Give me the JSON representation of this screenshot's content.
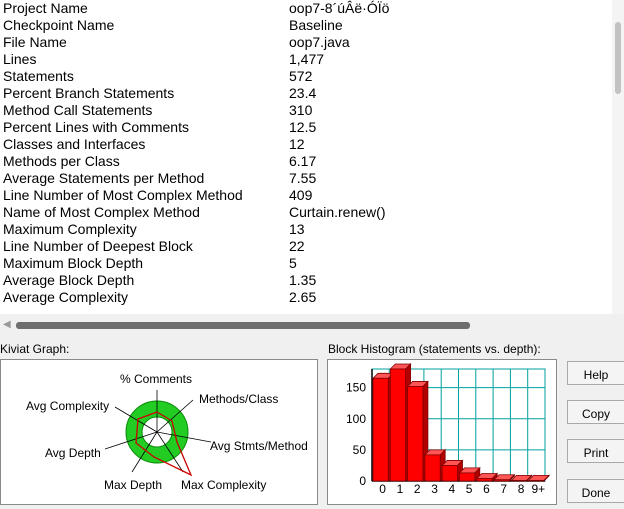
{
  "metrics": [
    {
      "label": "Project Name",
      "value": "oop7-8´úÂë·ÓÏö"
    },
    {
      "label": "Checkpoint Name",
      "value": "Baseline"
    },
    {
      "label": "File Name",
      "value": "oop7.java"
    },
    {
      "label": "Lines",
      "value": "1,477"
    },
    {
      "label": "Statements",
      "value": "572"
    },
    {
      "label": "Percent Branch Statements",
      "value": "23.4"
    },
    {
      "label": "Method Call Statements",
      "value": "310"
    },
    {
      "label": "Percent Lines with Comments",
      "value": "12.5"
    },
    {
      "label": "Classes and Interfaces",
      "value": "12"
    },
    {
      "label": "Methods per Class",
      "value": "6.17"
    },
    {
      "label": "Average Statements per Method",
      "value": "7.55"
    },
    {
      "label": "Line Number of Most Complex Method",
      "value": "409"
    },
    {
      "label": "Name of Most Complex Method",
      "value": "Curtain.renew()"
    },
    {
      "label": "Maximum Complexity",
      "value": "13"
    },
    {
      "label": "Line Number of Deepest Block",
      "value": "22"
    },
    {
      "label": "Maximum Block Depth",
      "value": "5"
    },
    {
      "label": "Average Block Depth",
      "value": "1.35"
    },
    {
      "label": "Average Complexity",
      "value": "2.65"
    }
  ],
  "kiviat": {
    "title": "Kiviat Graph:",
    "axes": [
      "% Comments",
      "Methods/Class",
      "Avg Stmts/Method",
      "Max Complexity",
      "Max Depth",
      "Avg Depth",
      "Avg Complexity"
    ]
  },
  "histogram": {
    "title": "Block Histogram (statements vs. depth):"
  },
  "buttons": {
    "help": "Help",
    "copy": "Copy",
    "print": "Print",
    "done": "Done"
  },
  "colors": {
    "bar": "#ff0000",
    "grid": "#00a0a0",
    "kiviat_ring": "#22cc22"
  },
  "chart_data": {
    "type": "bar",
    "categories": [
      "0",
      "1",
      "2",
      "3",
      "4",
      "5",
      "6",
      "7",
      "8",
      "9+"
    ],
    "values": [
      165,
      180,
      152,
      42,
      25,
      13,
      4,
      2,
      1,
      1
    ],
    "ylim": [
      0,
      180
    ],
    "yticks": [
      "0",
      "50",
      "100",
      "150"
    ],
    "grid": true
  }
}
